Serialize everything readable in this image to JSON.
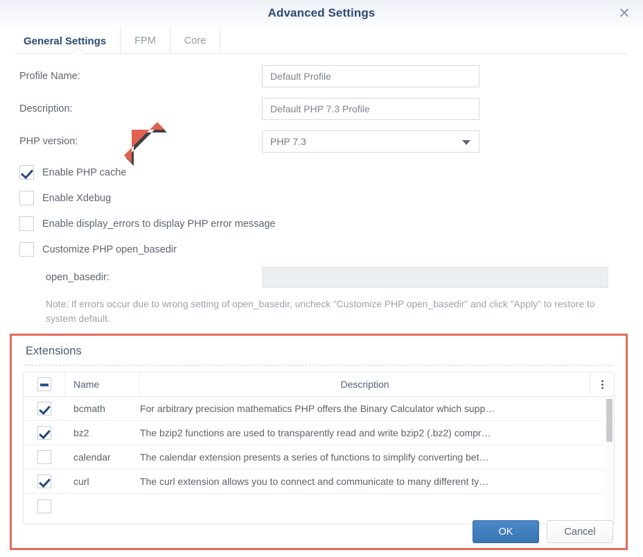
{
  "window": {
    "title": "Advanced Settings",
    "close_icon": "close-icon"
  },
  "tabs": [
    {
      "label": "General Settings",
      "active": true
    },
    {
      "label": "FPM",
      "active": false
    },
    {
      "label": "Core",
      "active": false
    }
  ],
  "general": {
    "fields": [
      {
        "label": "Profile Name:",
        "value": "Default Profile",
        "placeholder": ""
      },
      {
        "label": "Description:",
        "value": "Default PHP 7.3 Profile",
        "placeholder": ""
      }
    ],
    "php_version": {
      "label": "PHP version:",
      "value": "PHP 7.3",
      "caret_icon": "chevron-down-icon"
    },
    "checkboxes": [
      {
        "label": "Enable PHP cache",
        "checked": true
      },
      {
        "label": "Enable Xdebug",
        "checked": false
      },
      {
        "label": "Enable display_errors to display PHP error message",
        "checked": false
      },
      {
        "label": "Customize PHP open_basedir",
        "checked": false
      }
    ],
    "open_basedir": {
      "label": "open_basedir:",
      "value": "",
      "placeholder": ""
    },
    "note": "Note: If errors occur due to wrong setting of open_basedir, uncheck \"Customize PHP open_basedir\" and click \"Apply\" to restore to system default."
  },
  "annotation": {
    "arrow_icon": "red-arrow-pointing-down-left",
    "arrow_color": "#e2604f",
    "highlight_color": "#e2695c"
  },
  "extensions": {
    "title": "Extensions",
    "columns": {
      "select_all": "select-all-checkbox",
      "name": "Name",
      "description": "Description",
      "menu_icon": "kebab-menu-icon"
    },
    "header_checkbox_state": "indeterminate",
    "rows": [
      {
        "checked": true,
        "name": "bcmath",
        "description": "For arbitrary precision mathematics PHP offers the Binary Calculator which supp…"
      },
      {
        "checked": true,
        "name": "bz2",
        "description": "The bzip2 functions are used to transparently read and write bzip2 (.bz2) compr…"
      },
      {
        "checked": false,
        "name": "calendar",
        "description": "The calendar extension presents a series of functions to simplify converting bet…"
      },
      {
        "checked": true,
        "name": "curl",
        "description": "The curl extension allows you to connect and communicate to many different ty…"
      },
      {
        "checked": false,
        "name": "",
        "description": ""
      }
    ]
  },
  "footer": {
    "ok_label": "OK",
    "cancel_label": "Cancel",
    "ok_color": "#3a74b3"
  }
}
